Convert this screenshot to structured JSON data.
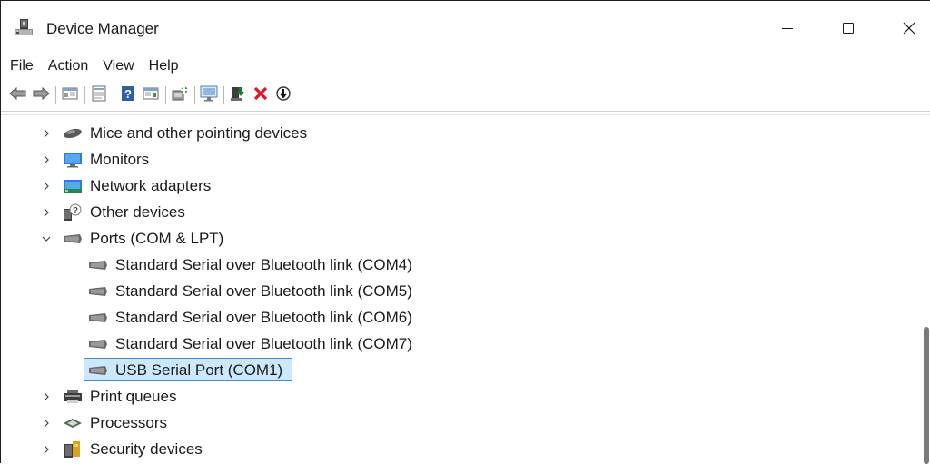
{
  "window": {
    "title": "Device Manager"
  },
  "menu": {
    "items": [
      "File",
      "Action",
      "View",
      "Help"
    ]
  },
  "toolbar": {
    "buttons": [
      "back-arrow-icon",
      "forward-arrow-icon",
      "show-hide-console-tree-icon",
      "properties-icon",
      "help-icon",
      "show-action-pane-icon",
      "scan-hardware-icon",
      "monitor-icon",
      "update-driver-icon",
      "uninstall-icon",
      "disable-device-icon"
    ],
    "colors": {
      "uninstall": "#e81123",
      "update": "#1c7a2d"
    }
  },
  "tree": {
    "items": [
      {
        "label": "Mice and other pointing devices",
        "expanded": false,
        "icon": "mouse-icon"
      },
      {
        "label": "Monitors",
        "expanded": false,
        "icon": "monitor-icon"
      },
      {
        "label": "Network adapters",
        "expanded": false,
        "icon": "network-adapter-icon"
      },
      {
        "label": "Other devices",
        "expanded": false,
        "icon": "unknown-device-icon"
      },
      {
        "label": "Ports (COM & LPT)",
        "expanded": true,
        "icon": "port-icon"
      },
      {
        "label": "Standard Serial over Bluetooth link (COM4)",
        "child": true,
        "icon": "port-icon"
      },
      {
        "label": "Standard Serial over Bluetooth link (COM5)",
        "child": true,
        "icon": "port-icon"
      },
      {
        "label": "Standard Serial over Bluetooth link (COM6)",
        "child": true,
        "icon": "port-icon"
      },
      {
        "label": "Standard Serial over Bluetooth link (COM7)",
        "child": true,
        "icon": "port-icon"
      },
      {
        "label": "USB Serial Port (COM1)",
        "child": true,
        "selected": true,
        "icon": "port-icon"
      },
      {
        "label": "Print queues",
        "expanded": false,
        "icon": "printer-icon"
      },
      {
        "label": "Processors",
        "expanded": false,
        "icon": "processor-icon"
      },
      {
        "label": "Security devices",
        "expanded": false,
        "icon": "security-device-icon"
      }
    ],
    "selection_color": "#cce8ff",
    "selection_border": "#3b8fd6"
  }
}
